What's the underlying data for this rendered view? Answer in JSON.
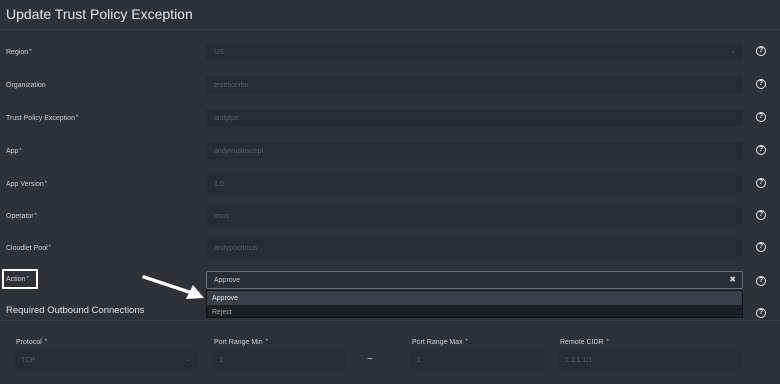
{
  "form": {
    "title": "Update Trust Policy Exception",
    "required_mark": "*",
    "help_icon_glyph": "?",
    "fields": [
      {
        "label": "Region",
        "required": true,
        "value": "US",
        "type": "select"
      },
      {
        "label": "Organization",
        "required": false,
        "value": "testmonitor",
        "type": "text"
      },
      {
        "label": "Trust Policy Exception",
        "required": true,
        "value": "andytpe",
        "type": "text"
      },
      {
        "label": "App",
        "required": true,
        "value": "andytrustexcept",
        "type": "text"
      },
      {
        "label": "App Version",
        "required": true,
        "value": "1.0",
        "type": "text"
      },
      {
        "label": "Operator",
        "required": true,
        "value": "tmus",
        "type": "text"
      },
      {
        "label": "Cloudlet Pool",
        "required": true,
        "value": "andypooltmus",
        "type": "text"
      }
    ],
    "action": {
      "label": "Action",
      "required": true,
      "value": "Approve",
      "clear_glyph": "✖",
      "options": [
        "Approve",
        "Reject"
      ],
      "highlighted_option": "Approve"
    }
  },
  "outbound": {
    "title": "Required Outbound Connections",
    "protocol": {
      "label": "Protocol",
      "value": "TCP"
    },
    "port_min": {
      "label": "Port Range Min",
      "value": "1"
    },
    "range_separator": "~",
    "port_max": {
      "label": "Port Range Max",
      "value": "1"
    },
    "remote_cidr": {
      "label": "Remote CIDR",
      "value": "1.1.1.1/1"
    }
  },
  "colors": {
    "background": "#2f3136",
    "field_bg": "#292b30",
    "dropdown_highlight": "#3a3f4b",
    "annotation": "#ffffff"
  }
}
